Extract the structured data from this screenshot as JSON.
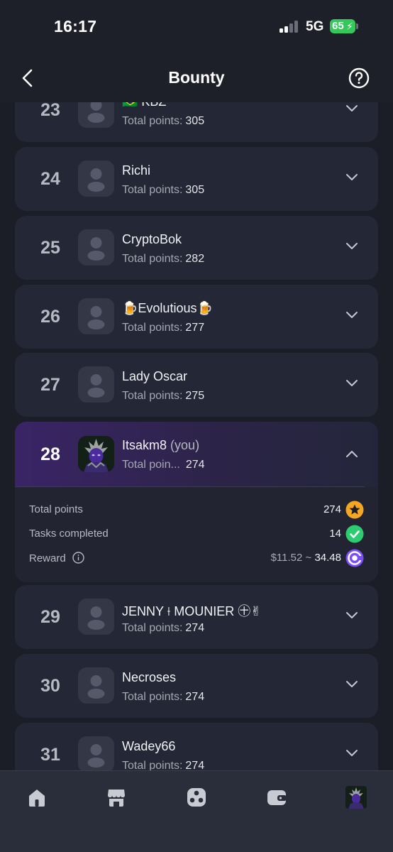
{
  "status": {
    "time": "16:17",
    "network": "5G",
    "battery": "65"
  },
  "header": {
    "title": "Bounty",
    "back_icon": "chevron-left-icon",
    "help_icon": "question-circle-icon"
  },
  "points_label": "Total points:",
  "truncated_points_label": "Total poin...",
  "leaderboard": [
    {
      "rank": "23",
      "name": "🇧🇷 KBZ",
      "points": "305"
    },
    {
      "rank": "24",
      "name": "Richi",
      "points": "305"
    },
    {
      "rank": "25",
      "name": "CryptoBok",
      "points": "282"
    },
    {
      "rank": "26",
      "name": "🍺Evolutious🍺",
      "points": "277"
    },
    {
      "rank": "27",
      "name": "Lady Oscar",
      "points": "275"
    },
    {
      "rank": "28",
      "name": "Itsakm8",
      "you": "(you)",
      "points": "274"
    },
    {
      "rank": "29",
      "name": "JENNY ⟊ MOUNIER ㊉✌",
      "points": "274"
    },
    {
      "rank": "30",
      "name": "Necroses",
      "points": "274"
    },
    {
      "rank": "31",
      "name": "Wadey66",
      "points": "274"
    }
  ],
  "details": {
    "total_points_label": "Total points",
    "total_points_value": "274",
    "tasks_label": "Tasks completed",
    "tasks_value": "14",
    "reward_label": "Reward",
    "reward_usd": "$11.52 ~",
    "reward_tokens": "34.48"
  },
  "nav": [
    "home-icon",
    "store-icon",
    "games-icon",
    "wallet-icon",
    "profile-avatar"
  ],
  "colors": {
    "accent_purple": "#3a2466",
    "star_badge": "#f5a623",
    "check_badge": "#2ecc71",
    "token_badge": "#7b4dff"
  }
}
